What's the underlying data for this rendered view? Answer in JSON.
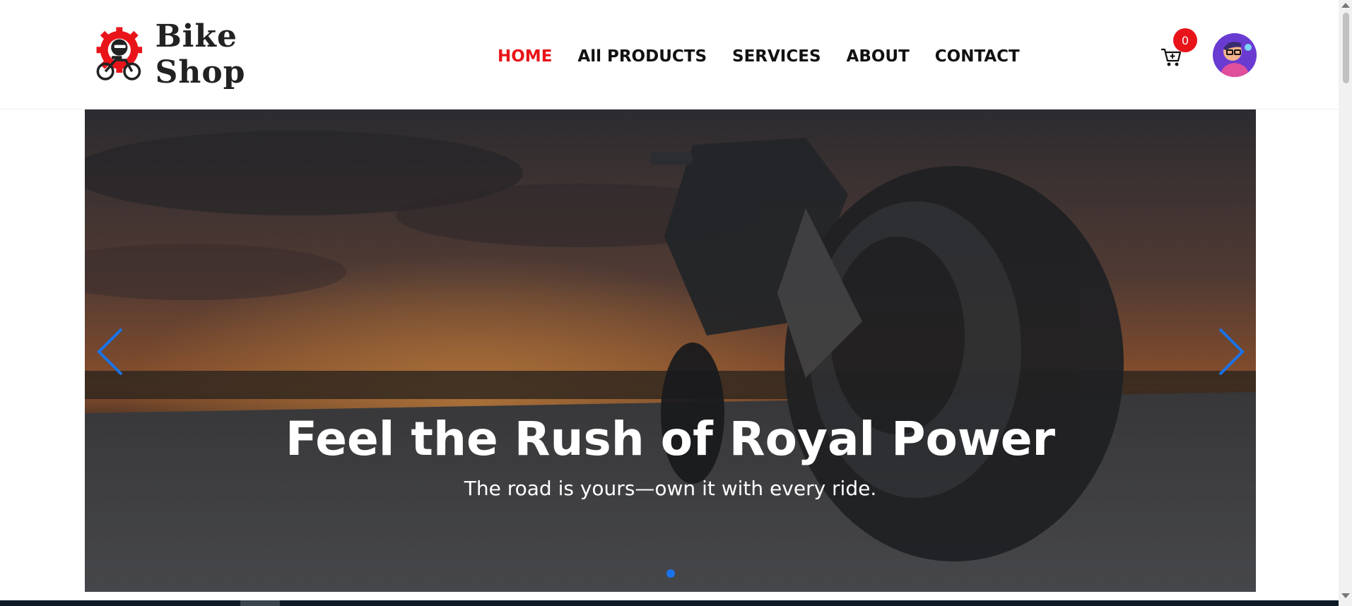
{
  "header": {
    "logo_text": "Bike Shop",
    "nav": [
      {
        "label": "HOME",
        "active": true
      },
      {
        "label": "All PRODUCTS",
        "active": false
      },
      {
        "label": "SERVICES",
        "active": false
      },
      {
        "label": "ABOUT",
        "active": false
      },
      {
        "label": "CONTACT",
        "active": false
      }
    ],
    "cart_count": "0",
    "cart_icon": "cart-icon",
    "avatar_icon": "user-avatar"
  },
  "hero": {
    "title": "Feel the Rush of Royal Power",
    "subtitle": "The road is yours—own it with every ride.",
    "prev_icon": "chevron-left-icon",
    "next_icon": "chevron-right-icon",
    "slide_count": 1,
    "active_slide": 1
  },
  "colors": {
    "accent": "#e8141a",
    "nav_text": "#111111",
    "slider_controls": "#1a73e8"
  }
}
